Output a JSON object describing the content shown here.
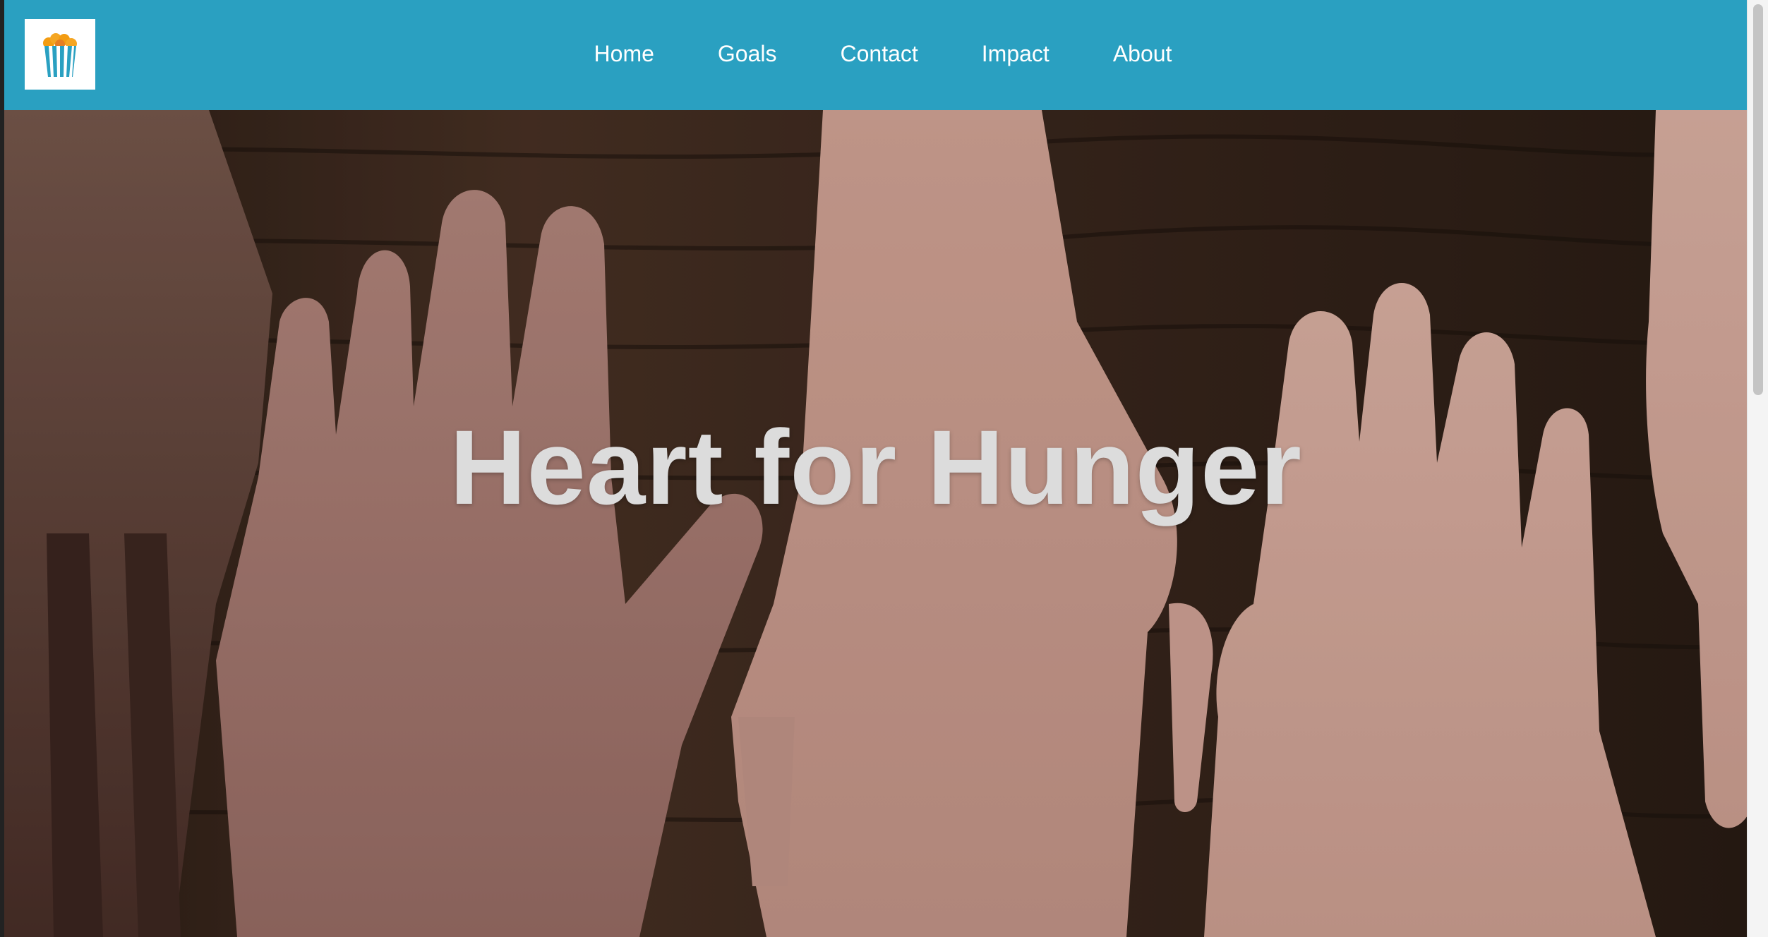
{
  "nav": {
    "logo_icon": "popcorn-bucket-icon",
    "links": [
      "Home",
      "Goals",
      "Contact",
      "Impact",
      "About"
    ]
  },
  "hero": {
    "title": "Heart for Hunger",
    "background": "hands-on-wooden-table-photo"
  },
  "colors": {
    "navbar": "#2aa0c1",
    "nav_text": "#ffffff",
    "hero_title": "#dcdcdc"
  }
}
